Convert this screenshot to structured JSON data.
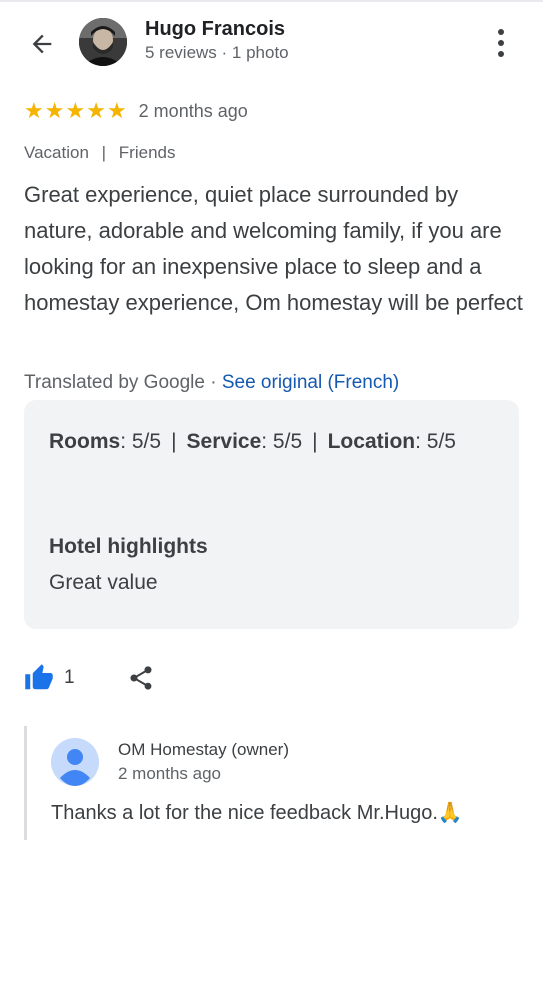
{
  "reviewer": {
    "name": "Hugo Francois",
    "meta": "5 reviews · 1 photo"
  },
  "review": {
    "stars": 5,
    "star_glyph": "★",
    "time_ago": "2 months ago",
    "tags": [
      "Vacation",
      "Friends"
    ],
    "tag_separator": "|",
    "text": "Great experience, quiet place surrounded by nature, adorable and welcoming family, if you are looking for an inexpensive place to sleep and a homestay experience, Om homestay will be perfect",
    "translated_by": "Translated by Google ·",
    "see_original": "See original (French)"
  },
  "details": {
    "ratings": [
      {
        "label": "Rooms",
        "value": ": 5/5"
      },
      {
        "label": "Service",
        "value": ": 5/5"
      },
      {
        "label": "Location",
        "value": ": 5/5"
      }
    ],
    "separator": "|",
    "highlights_title": "Hotel highlights",
    "highlights_value": "Great value"
  },
  "actions": {
    "like_count": "1",
    "like_icon": "thumbs-up-icon",
    "share_icon": "share-icon"
  },
  "owner_reply": {
    "name": "OM Homestay (owner)",
    "time_ago": "2 months ago",
    "text": "Thanks a lot for the nice feedback Mr.Hugo.🙏"
  },
  "colors": {
    "star": "#f4b400",
    "link": "#1558b0",
    "like": "#1a73e8",
    "card_bg": "#f1f3f4",
    "owner_avatar_bg": "#c6dafc",
    "owner_avatar_fg": "#4285f4"
  }
}
